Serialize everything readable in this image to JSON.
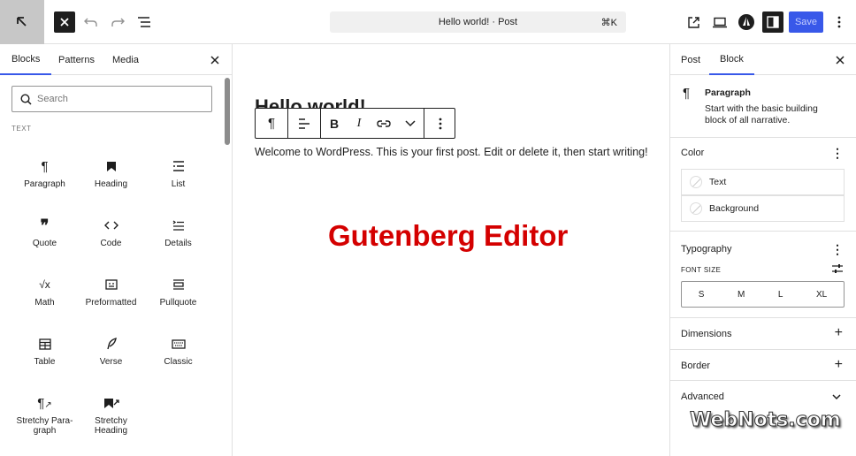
{
  "topbar": {
    "post_title_pill": "Hello world! · Post",
    "shortcut": "⌘K",
    "save_label": "Save"
  },
  "left_panel": {
    "tabs": [
      "Blocks",
      "Patterns",
      "Media"
    ],
    "search_placeholder": "Search",
    "section_label": "TEXT",
    "blocks": [
      {
        "label": "Paragraph",
        "icon": "paragraph-icon"
      },
      {
        "label": "Heading",
        "icon": "heading-icon"
      },
      {
        "label": "List",
        "icon": "list-icon"
      },
      {
        "label": "Quote",
        "icon": "quote-icon"
      },
      {
        "label": "Code",
        "icon": "code-icon"
      },
      {
        "label": "Details",
        "icon": "details-icon"
      },
      {
        "label": "Math",
        "icon": "math-icon"
      },
      {
        "label": "Preformatted",
        "icon": "preformatted-icon"
      },
      {
        "label": "Pullquote",
        "icon": "pullquote-icon"
      },
      {
        "label": "Table",
        "icon": "table-icon"
      },
      {
        "label": "Verse",
        "icon": "verse-icon"
      },
      {
        "label": "Classic",
        "icon": "classic-icon"
      },
      {
        "label": "Stretchy Para-\ngraph",
        "icon": "stretchy-paragraph-icon"
      },
      {
        "label": "Stretchy\nHeading",
        "icon": "stretchy-heading-icon"
      }
    ]
  },
  "canvas": {
    "title": "Hello world!",
    "paragraph": "Welcome to WordPress. This is your first post. Edit or delete it, then start writing!",
    "watermark": "Gutenberg Editor"
  },
  "right_panel": {
    "tabs": [
      "Post",
      "Block"
    ],
    "block_card": {
      "title": "Paragraph",
      "description": "Start with the basic building block of all narrative."
    },
    "color": {
      "heading": "Color",
      "options": [
        "Text",
        "Background"
      ]
    },
    "typography": {
      "heading": "Typography",
      "font_size_label": "FONT SIZE",
      "sizes": [
        "S",
        "M",
        "L",
        "XL"
      ]
    },
    "dimensions_heading": "Dimensions",
    "border_heading": "Border",
    "advanced_heading": "Advanced"
  },
  "watermark_logo": "WebNots.com",
  "colors": {
    "accent": "#3858e9",
    "watermark_red": "#d40000"
  }
}
